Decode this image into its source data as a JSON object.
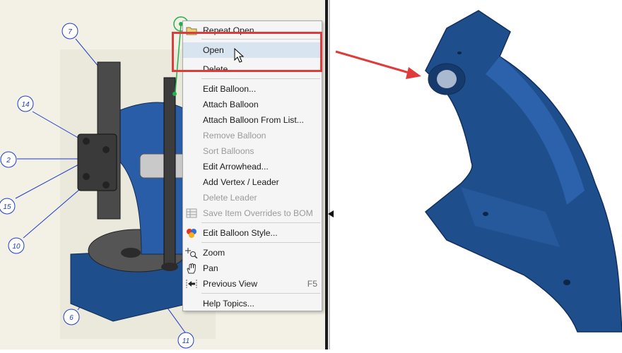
{
  "context_menu": {
    "items": [
      {
        "label": "Repeat Open",
        "shortcut": "",
        "icon": "folder-icon",
        "disabled": false
      },
      {
        "label": "Open",
        "shortcut": "",
        "icon": "",
        "disabled": false,
        "hovered": true
      },
      {
        "label": "Delete",
        "shortcut": "",
        "icon": "",
        "disabled": false
      },
      {
        "label": "Edit Balloon...",
        "shortcut": "",
        "icon": "",
        "disabled": false
      },
      {
        "label": "Attach Balloon",
        "shortcut": "",
        "icon": "",
        "disabled": false
      },
      {
        "label": "Attach Balloon From List...",
        "shortcut": "",
        "icon": "",
        "disabled": false
      },
      {
        "label": "Remove Balloon",
        "shortcut": "",
        "icon": "",
        "disabled": true
      },
      {
        "label": "Sort Balloons",
        "shortcut": "",
        "icon": "",
        "disabled": true
      },
      {
        "label": "Edit Arrowhead...",
        "shortcut": "",
        "icon": "",
        "disabled": false
      },
      {
        "label": "Add Vertex / Leader",
        "shortcut": "",
        "icon": "",
        "disabled": false
      },
      {
        "label": "Delete Leader",
        "shortcut": "",
        "icon": "",
        "disabled": true
      },
      {
        "label": "Save Item Overrides to BOM",
        "shortcut": "",
        "icon": "bom-table-icon",
        "disabled": true
      },
      {
        "label": "Edit Balloon Style...",
        "shortcut": "",
        "icon": "style-palette-icon",
        "disabled": false
      },
      {
        "label": "Zoom",
        "shortcut": "",
        "icon": "zoom-icon",
        "disabled": false
      },
      {
        "label": "Pan",
        "shortcut": "",
        "icon": "pan-hand-icon",
        "disabled": false
      },
      {
        "label": "Previous View",
        "shortcut": "F5",
        "icon": "previous-view-icon",
        "disabled": false
      },
      {
        "label": "Help Topics...",
        "shortcut": "",
        "icon": "",
        "disabled": false
      }
    ]
  },
  "balloons": [
    {
      "number": "7"
    },
    {
      "number": "14"
    },
    {
      "number": "2"
    },
    {
      "number": "15"
    },
    {
      "number": "10"
    },
    {
      "number": "6"
    },
    {
      "number": "11"
    }
  ],
  "colors": {
    "highlight": "#e03a3a",
    "part_blue": "#1f4e8c",
    "balloon_blue": "#1e3ccc",
    "menu_hover": "#d9e4f1",
    "selected_green": "#22b14c"
  }
}
